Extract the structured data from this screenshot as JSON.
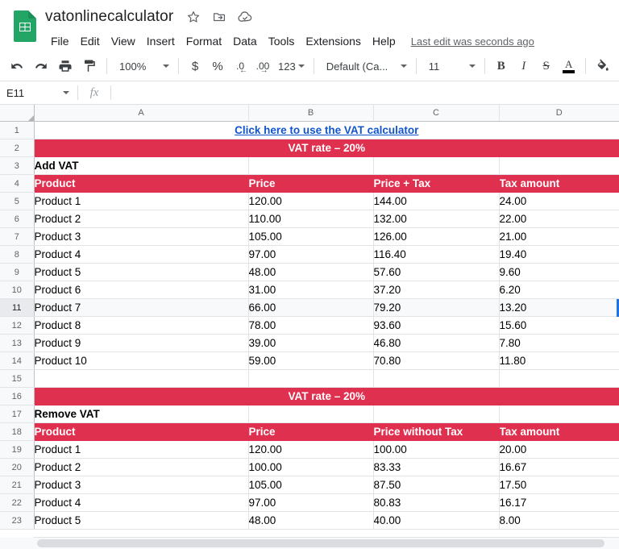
{
  "app": {
    "name": "Google Sheets",
    "logo_icon": "sheets-logo-icon",
    "accent_red": "#e0304f",
    "link_blue": "#1155cc",
    "selection_blue": "#1a73e8"
  },
  "titlebar": {
    "doc_title": "vatonlinecalculator",
    "icons": [
      {
        "name": "star-icon",
        "label": "Star"
      },
      {
        "name": "move-to-folder-icon",
        "label": "Move"
      },
      {
        "name": "cloud-saved-icon",
        "label": "Saved to Drive"
      }
    ],
    "menus": [
      "File",
      "Edit",
      "View",
      "Insert",
      "Format",
      "Data",
      "Tools",
      "Extensions",
      "Help"
    ],
    "last_edit": "Last edit was seconds ago"
  },
  "toolbar": {
    "undo_icon": "undo-icon",
    "redo_icon": "redo-icon",
    "print_icon": "print-icon",
    "paint_format_icon": "paint-format-icon",
    "zoom": "100%",
    "currency_label": "$",
    "percent_label": "%",
    "decrease_decimal_label": ".0",
    "increase_decimal_label": ".00",
    "more_formats_label": "123",
    "font_family": "Default (Ca...",
    "font_size": "11",
    "bold_label": "B",
    "italic_label": "I",
    "strikethrough_label": "S",
    "text_color_label": "A",
    "fill_color_icon": "fill-color-icon"
  },
  "formula_bar": {
    "name_box": "E11",
    "fx_label": "fx",
    "formula_value": "",
    "formula_placeholder": ""
  },
  "grid": {
    "columns": [
      "A",
      "B",
      "C",
      "D"
    ],
    "selected_cell": "E11",
    "selected_row": 11,
    "rows": [
      {
        "n": 1,
        "type": "link",
        "text": "Click here to use the VAT calculator"
      },
      {
        "n": 2,
        "type": "band",
        "text": "VAT rate –  20%"
      },
      {
        "n": 3,
        "type": "data",
        "cells": [
          "Add VAT",
          "",
          "",
          ""
        ],
        "bold": true
      },
      {
        "n": 4,
        "type": "header",
        "cells": [
          "Product",
          "Price",
          "Price + Tax",
          "Tax amount"
        ]
      },
      {
        "n": 5,
        "type": "data",
        "cells": [
          "Product 1",
          "120.00",
          "144.00",
          "24.00"
        ]
      },
      {
        "n": 6,
        "type": "data",
        "cells": [
          "Product 2",
          "110.00",
          "132.00",
          "22.00"
        ]
      },
      {
        "n": 7,
        "type": "data",
        "cells": [
          "Product 3",
          "105.00",
          "126.00",
          "21.00"
        ]
      },
      {
        "n": 8,
        "type": "data",
        "cells": [
          "Product 4",
          "97.00",
          "116.40",
          "19.40"
        ]
      },
      {
        "n": 9,
        "type": "data",
        "cells": [
          "Product 5",
          "48.00",
          "57.60",
          "9.60"
        ]
      },
      {
        "n": 10,
        "type": "data",
        "cells": [
          "Product 6",
          "31.00",
          "37.20",
          "6.20"
        ]
      },
      {
        "n": 11,
        "type": "data",
        "cells": [
          "Product 7",
          "66.00",
          "79.20",
          "13.20"
        ]
      },
      {
        "n": 12,
        "type": "data",
        "cells": [
          "Product 8",
          "78.00",
          "93.60",
          "15.60"
        ]
      },
      {
        "n": 13,
        "type": "data",
        "cells": [
          "Product 9",
          "39.00",
          "46.80",
          "7.80"
        ]
      },
      {
        "n": 14,
        "type": "data",
        "cells": [
          "Product 10",
          "59.00",
          "70.80",
          "11.80"
        ]
      },
      {
        "n": 15,
        "type": "data",
        "cells": [
          "",
          "",
          "",
          ""
        ]
      },
      {
        "n": 16,
        "type": "band",
        "text": "VAT rate –  20%"
      },
      {
        "n": 17,
        "type": "data",
        "cells": [
          "Remove VAT",
          "",
          "",
          ""
        ],
        "bold": true
      },
      {
        "n": 18,
        "type": "header",
        "cells": [
          "Product",
          "Price",
          "Price without Tax",
          "Tax amount"
        ]
      },
      {
        "n": 19,
        "type": "data",
        "cells": [
          "Product 1",
          "120.00",
          "100.00",
          "20.00"
        ]
      },
      {
        "n": 20,
        "type": "data",
        "cells": [
          "Product 2",
          "100.00",
          "83.33",
          "16.67"
        ]
      },
      {
        "n": 21,
        "type": "data",
        "cells": [
          "Product 3",
          "105.00",
          "87.50",
          "17.50"
        ]
      },
      {
        "n": 22,
        "type": "data",
        "cells": [
          "Product 4",
          "97.00",
          "80.83",
          "16.17"
        ]
      },
      {
        "n": 23,
        "type": "data",
        "cells": [
          "Product 5",
          "48.00",
          "40.00",
          "8.00"
        ]
      }
    ]
  }
}
